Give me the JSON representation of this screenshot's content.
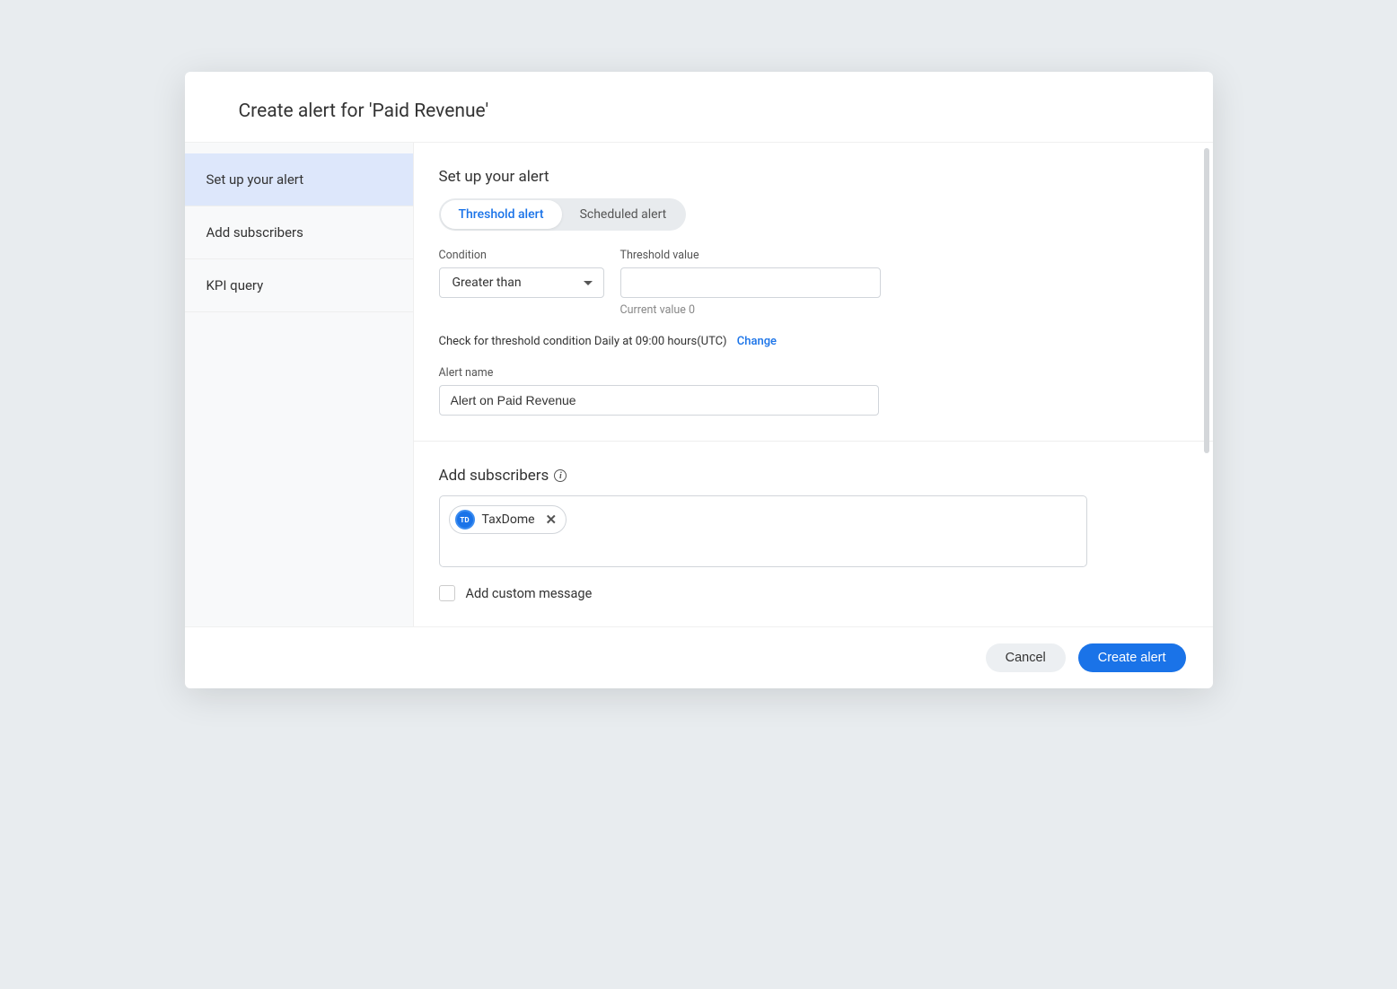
{
  "header": {
    "title": "Create alert for 'Paid Revenue'"
  },
  "sidebar": {
    "items": [
      {
        "label": "Set up your alert",
        "active": true
      },
      {
        "label": "Add subscribers",
        "active": false
      },
      {
        "label": "KPI query",
        "active": false
      }
    ]
  },
  "setup": {
    "section_title": "Set up your alert",
    "toggle": {
      "threshold": "Threshold alert",
      "scheduled": "Scheduled alert"
    },
    "condition": {
      "label": "Condition",
      "value": "Greater than"
    },
    "threshold": {
      "label": "Threshold value",
      "value": "",
      "helper": "Current value  0"
    },
    "schedule_text": "Check for threshold condition Daily at 09:00 hours(UTC)",
    "change_label": "Change",
    "alert_name": {
      "label": "Alert name",
      "value": "Alert on Paid Revenue"
    }
  },
  "subscribers": {
    "section_title": "Add subscribers",
    "chip": {
      "avatar_text": "TD",
      "label": "TaxDome"
    },
    "custom_message_label": "Add custom message"
  },
  "footer": {
    "cancel": "Cancel",
    "create": "Create alert"
  }
}
